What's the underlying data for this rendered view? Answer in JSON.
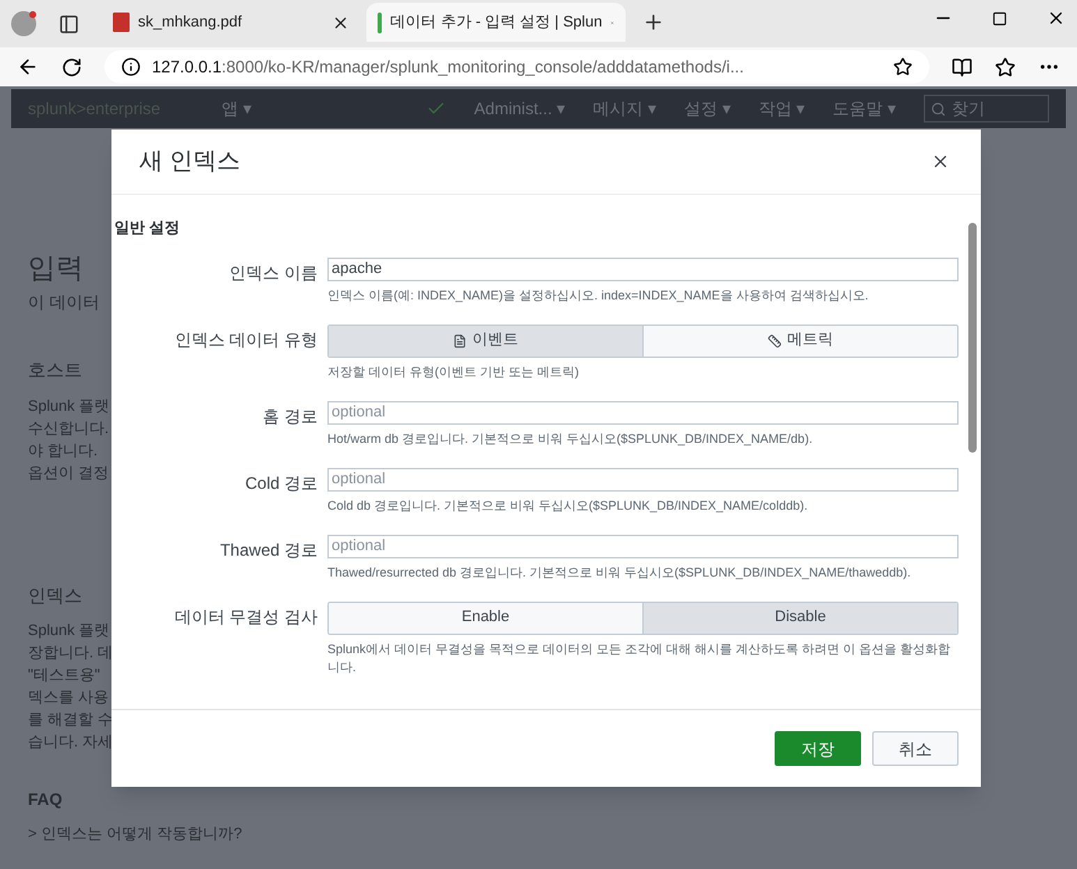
{
  "browser": {
    "tabs": [
      {
        "title": "sk_mhkang.pdf",
        "kind": "pdf",
        "selected": false
      },
      {
        "title": "데이터 추가 - 입력 설정 | Splun",
        "kind": "splunk",
        "selected": true
      }
    ],
    "url_host": "127.0.0.1",
    "url_rest": ":8000/ko-KR/manager/splunk_monitoring_console/adddatamethods/i..."
  },
  "splunk_nav": {
    "logo_prefix": "splunk>",
    "logo_suffix": "enterprise",
    "app_menu": "앱 ▾",
    "menus": [
      "Administ... ▾",
      "메시지 ▾",
      "설정 ▾",
      "작업 ▾",
      "도움말 ▾"
    ],
    "search_placeholder": "찾기"
  },
  "background": {
    "title": "입력",
    "subtitle": "이 데이터",
    "sections": [
      {
        "heading": "호스트",
        "lines": [
          "Splunk 플랫",
          "수신합니다.",
          "야 합니다.",
          "옵션이 결정"
        ]
      },
      {
        "heading": "인덱스",
        "lines": [
          "Splunk 플랫",
          "장합니다. 데",
          "\"테스트용\"",
          "덱스를 사용",
          "를 해결할 수",
          "습니다. 자세"
        ]
      }
    ],
    "faq_heading": "FAQ",
    "faq_items": [
      "> 인덱스는 어떻게 작동합니까?"
    ]
  },
  "modal": {
    "title": "새 인덱스",
    "section": "일반 설정",
    "fields": [
      {
        "kind": "text",
        "label": "인덱스 이름",
        "value": "apache",
        "help": "인덱스 이름(예: INDEX_NAME)을 설정하십시오. index=INDEX_NAME을 사용하여 검색하십시오."
      },
      {
        "kind": "icon_segmented",
        "label": "인덱스 데이터 유형",
        "options": [
          {
            "label": "이벤트",
            "selected": true
          },
          {
            "label": "메트릭",
            "selected": false
          }
        ],
        "help": "저장할 데이터 유형(이벤트 기반 또는 메트릭)"
      },
      {
        "kind": "text",
        "label": "홈 경로",
        "placeholder": "optional",
        "help": "Hot/warm db 경로입니다. 기본적으로 비워 두십시오($SPLUNK_DB/INDEX_NAME/db)."
      },
      {
        "kind": "text",
        "label": "Cold 경로",
        "placeholder": "optional",
        "help": "Cold db 경로입니다. 기본적으로 비워 두십시오($SPLUNK_DB/INDEX_NAME/colddb)."
      },
      {
        "kind": "text",
        "label": "Thawed 경로",
        "placeholder": "optional",
        "help": "Thawed/resurrected db 경로입니다. 기본적으로 비워 두십시오($SPLUNK_DB/INDEX_NAME/thaweddb)."
      },
      {
        "kind": "segmented",
        "label": "데이터 무결성 검사",
        "options": [
          {
            "label": "Enable",
            "selected": false
          },
          {
            "label": "Disable",
            "selected": true
          }
        ],
        "help": "Splunk에서 데이터 무결성을 목적으로 데이터의 모든 조각에 대해 해시를 계산하도록 하려면 이 옵션을 활성화합니다."
      }
    ],
    "buttons": [
      {
        "label": "저장",
        "kind": "primary"
      },
      {
        "label": "취소",
        "kind": "secondary"
      }
    ]
  }
}
